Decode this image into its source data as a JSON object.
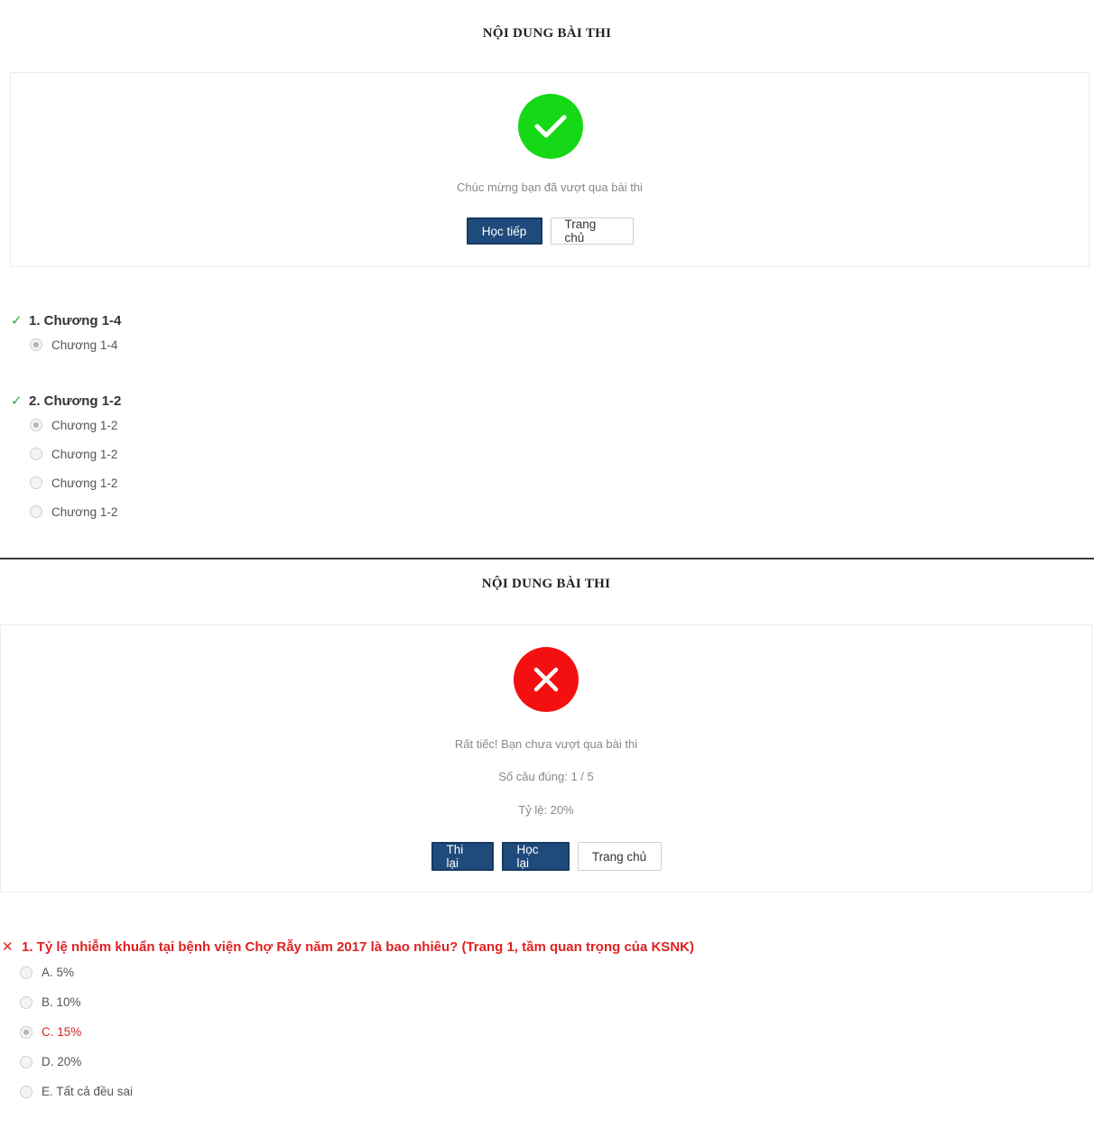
{
  "pass_screen": {
    "title": "NỘI DUNG BÀI THI",
    "message": "Chúc mừng bạn đã vượt qua bài thi",
    "buttons": {
      "continue": "Học tiếp",
      "home": "Trang chủ"
    },
    "status_icon": "check-icon",
    "status_color": "#16d816",
    "questions": [
      {
        "label": "1. Chương 1-4",
        "result": "correct",
        "options": [
          {
            "label": "Chương 1-4",
            "selected": true
          }
        ]
      },
      {
        "label": "2. Chương 1-2",
        "result": "correct",
        "options": [
          {
            "label": "Chương 1-2",
            "selected": true
          },
          {
            "label": "Chương 1-2",
            "selected": false
          },
          {
            "label": "Chương 1-2",
            "selected": false
          },
          {
            "label": "Chương 1-2",
            "selected": false
          }
        ]
      }
    ]
  },
  "fail_screen": {
    "title": "NỘI DUNG BÀI THI",
    "message": "Rất tiếc! Bạn chưa vượt qua bài thi",
    "score": "Số câu đúng: 1 / 5",
    "rate": "Tỷ lệ: 20%",
    "buttons": {
      "retry": "Thi lại",
      "relearn": "Học lại",
      "home": "Trang chủ"
    },
    "status_icon": "x-icon",
    "status_color": "#f41010",
    "question": {
      "label": "1. Tỷ lệ nhiễm khuẩn tại bệnh viện Chợ Rẫy năm 2017 là bao nhiêu? (Trang 1, tầm quan trọng của KSNK)",
      "result": "wrong",
      "options": [
        {
          "label": "A. 5%",
          "selected": false
        },
        {
          "label": "B. 10%",
          "selected": false
        },
        {
          "label": "C. 15%",
          "selected": true
        },
        {
          "label": "D. 20%",
          "selected": false
        },
        {
          "label": "E. Tất cả đều sai",
          "selected": false
        }
      ]
    }
  },
  "colors": {
    "primary_button": "#1f4a7c",
    "correct": "#2eaa3c",
    "wrong": "#e02020"
  }
}
